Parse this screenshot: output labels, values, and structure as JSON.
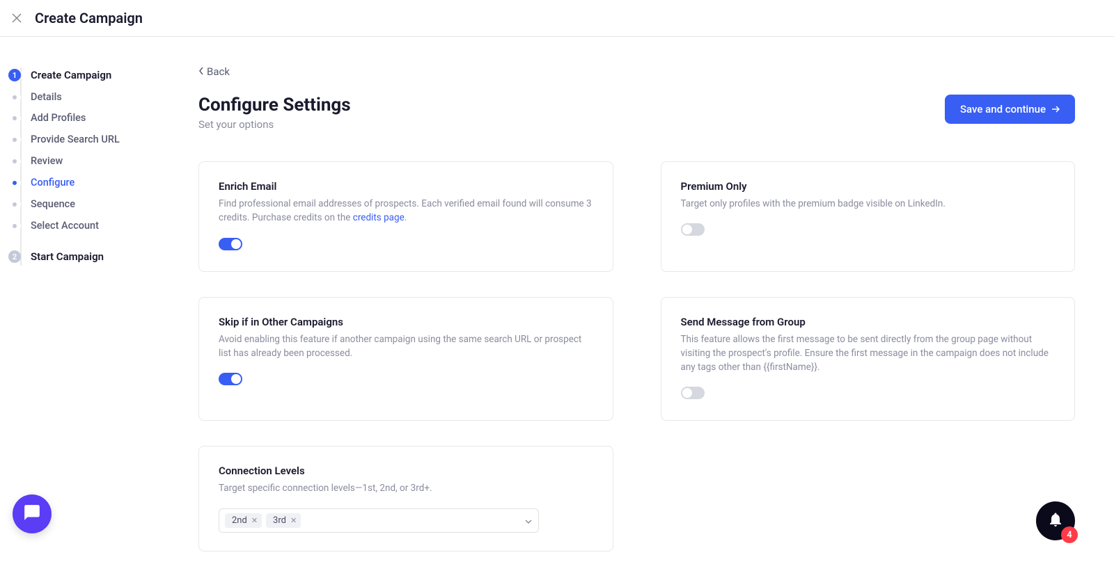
{
  "header": {
    "title": "Create Campaign"
  },
  "sidebar": {
    "step1": {
      "num": "1",
      "label": "Create Campaign",
      "items": [
        {
          "label": "Details"
        },
        {
          "label": "Add Profiles"
        },
        {
          "label": "Provide Search URL"
        },
        {
          "label": "Review"
        },
        {
          "label": "Configure"
        },
        {
          "label": "Sequence"
        },
        {
          "label": "Select Account"
        }
      ]
    },
    "step2": {
      "num": "2",
      "label": "Start Campaign"
    }
  },
  "main": {
    "back": "Back",
    "title": "Configure Settings",
    "subtitle": "Set your options",
    "save": "Save and continue"
  },
  "cards": {
    "enrich": {
      "title": "Enrich Email",
      "desc_pre": "Find professional email addresses of prospects. Each verified email found will consume 3 credits. Purchase credits on the ",
      "link": "credits page",
      "desc_post": "."
    },
    "premium": {
      "title": "Premium Only",
      "desc": "Target only profiles with the premium badge visible on LinkedIn."
    },
    "skip": {
      "title": "Skip if in Other Campaigns",
      "desc": "Avoid enabling this feature if another campaign using the same search URL or prospect list has already been processed."
    },
    "group": {
      "title": "Send Message from Group",
      "desc": "This feature allows the first message to be sent directly from the group page without visiting the prospect's profile. Ensure the first message in the campaign does not include any tags other than {{firstName}}."
    },
    "conn": {
      "title": "Connection Levels",
      "desc": "Target specific connection levels—1st, 2nd, or 3rd+.",
      "tags": [
        "2nd",
        "3rd"
      ]
    }
  },
  "notif": {
    "count": "4"
  }
}
